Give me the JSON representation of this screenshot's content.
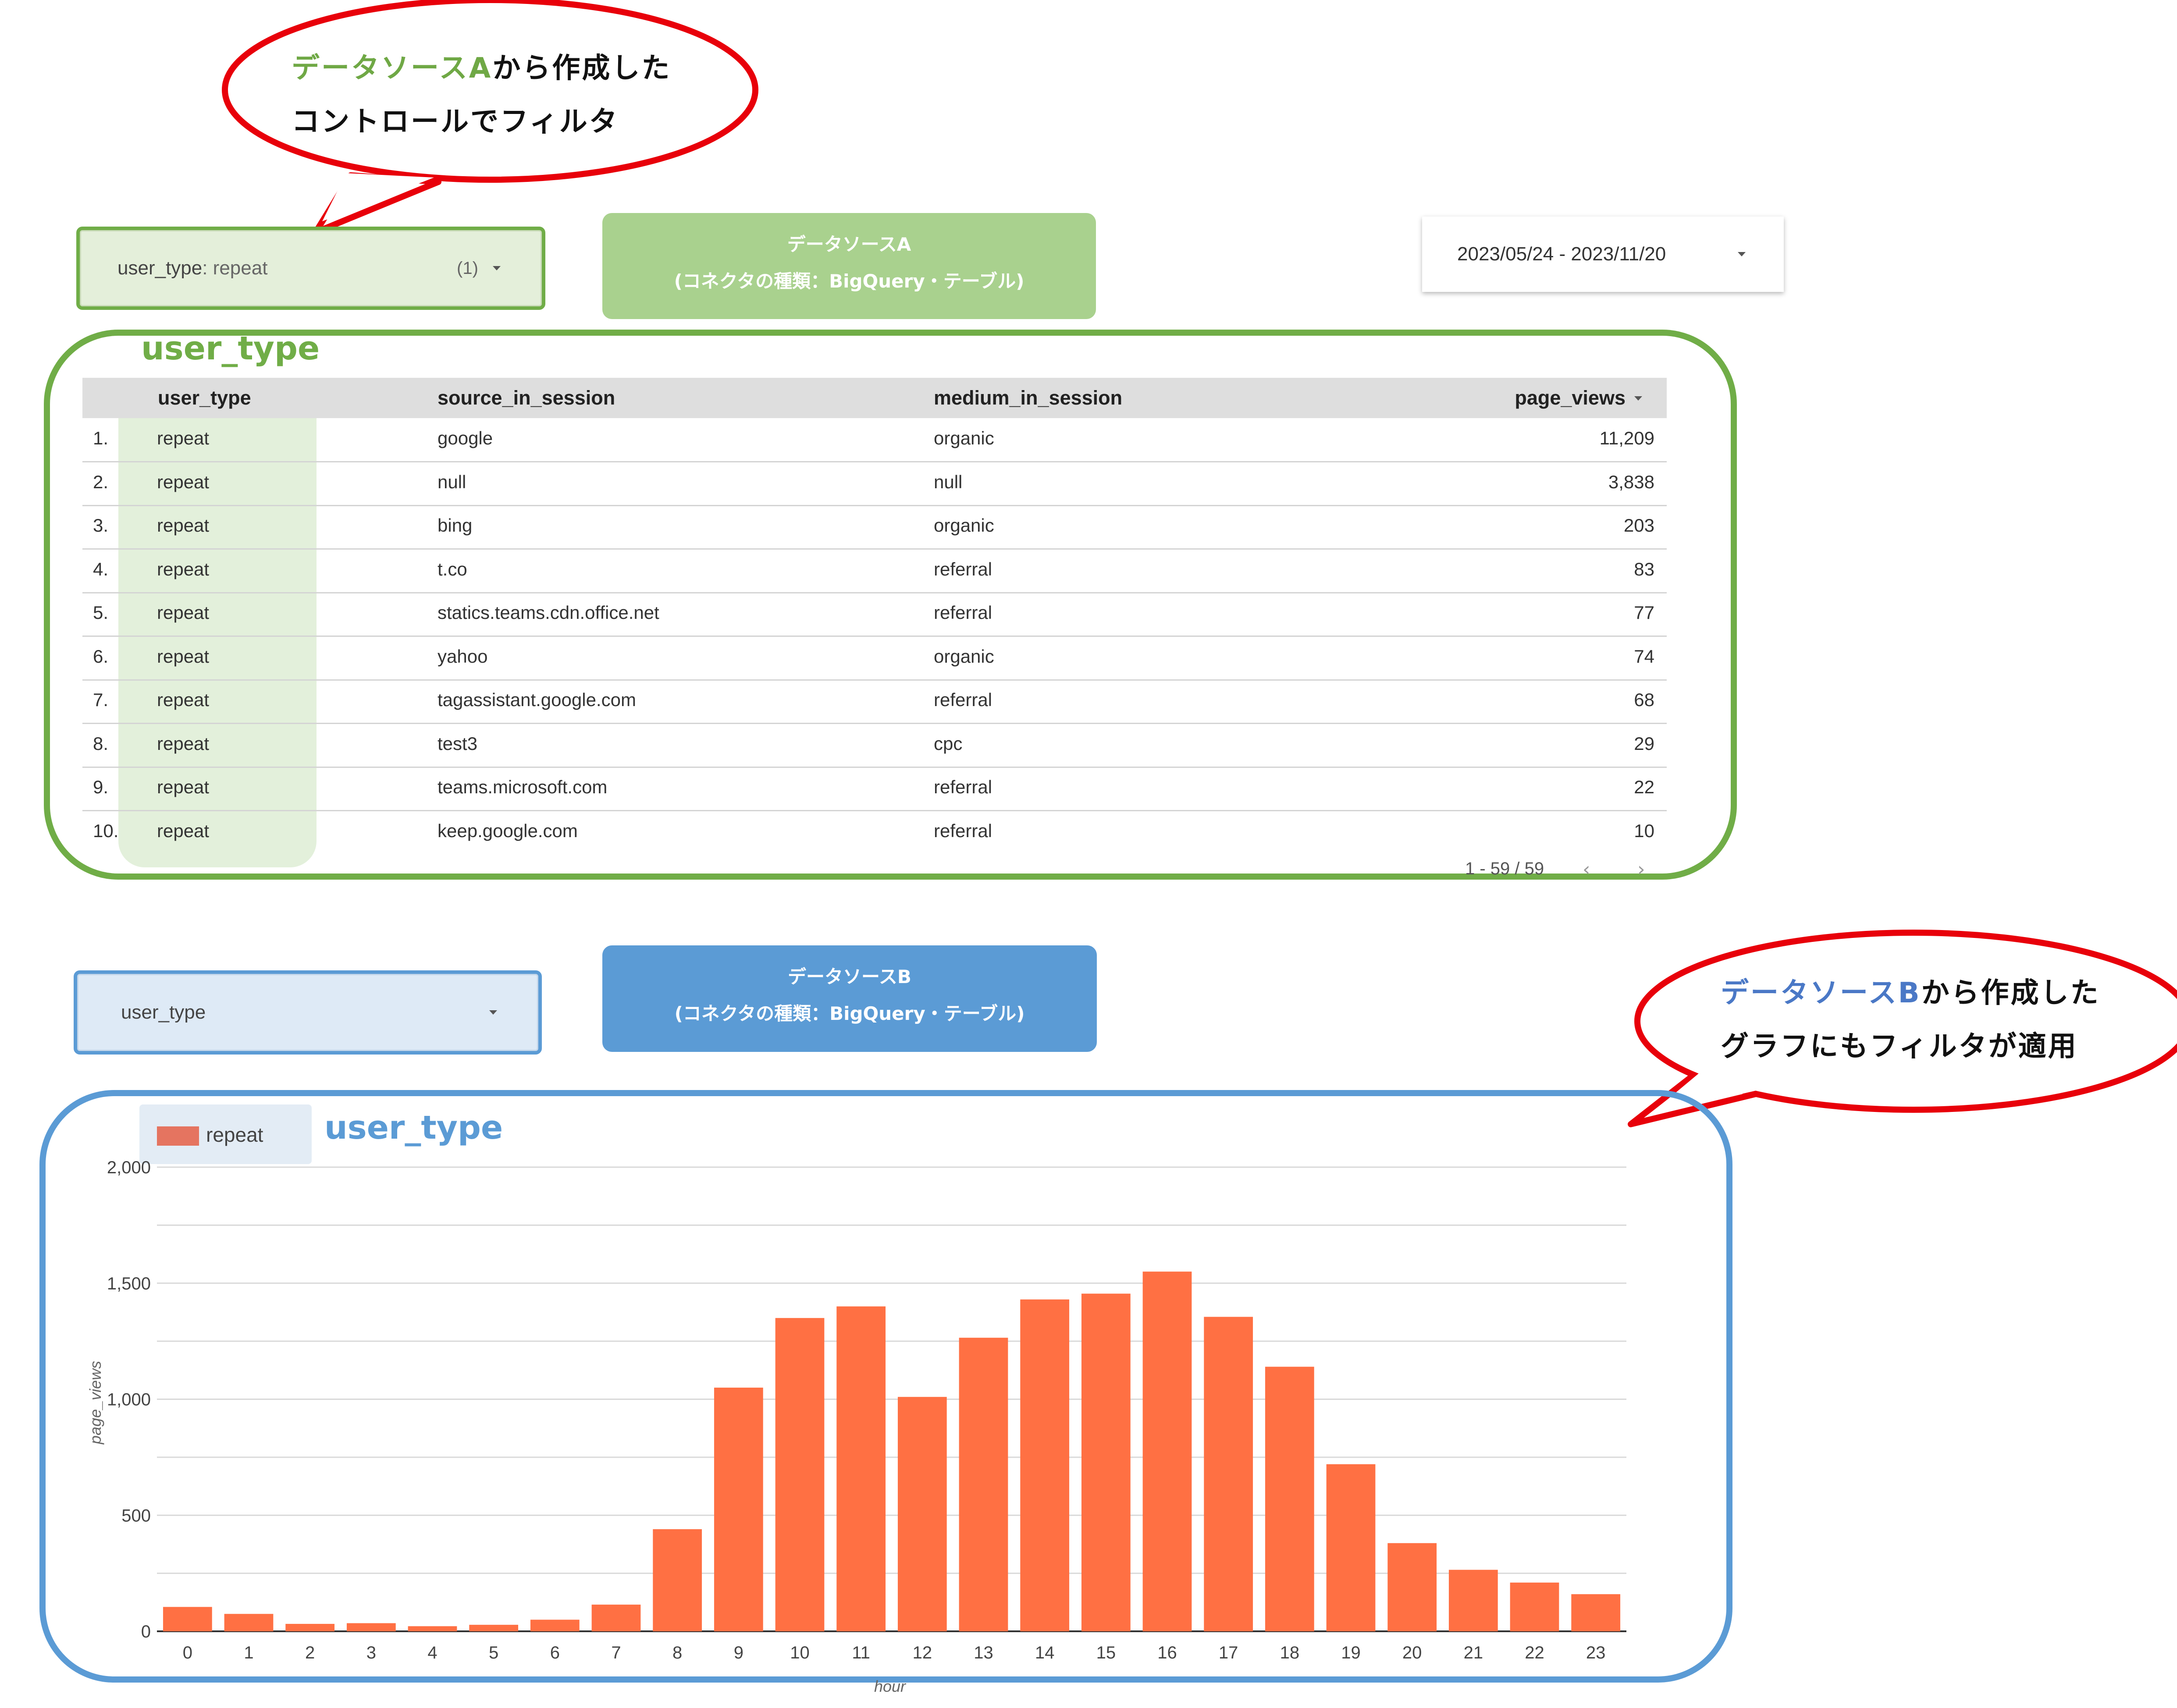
{
  "callout_a": {
    "line1_accent": "データソースA",
    "line1_rest": "から作成した",
    "line2": "コントロールでフィルタ"
  },
  "callout_b": {
    "line1_accent": "データソースB",
    "line1_rest": "から作成した",
    "line2": "グラフにもフィルタが適用"
  },
  "filter_a": {
    "label": "user_type",
    "value": ": repeat",
    "count": "(1)"
  },
  "filter_b": {
    "label": "user_type"
  },
  "datasource_a": {
    "title": "データソースA",
    "subtitle": "(コネクタの種類：BigQuery・テーブル)"
  },
  "datasource_b": {
    "title": "データソースB",
    "subtitle": "(コネクタの種類：BigQuery・テーブル)"
  },
  "date_range": {
    "value": "2023/05/24 - 2023/11/20"
  },
  "table_section": {
    "label": "user_type",
    "columns": [
      "user_type",
      "source_in_session",
      "medium_in_session",
      "page_views"
    ],
    "rows": [
      {
        "n": "1.",
        "user_type": "repeat",
        "source": "google",
        "medium": "organic",
        "views": "11,209"
      },
      {
        "n": "2.",
        "user_type": "repeat",
        "source": "null",
        "medium": "null",
        "views": "3,838"
      },
      {
        "n": "3.",
        "user_type": "repeat",
        "source": "bing",
        "medium": "organic",
        "views": "203"
      },
      {
        "n": "4.",
        "user_type": "repeat",
        "source": "t.co",
        "medium": "referral",
        "views": "83"
      },
      {
        "n": "5.",
        "user_type": "repeat",
        "source": "statics.teams.cdn.office.net",
        "medium": "referral",
        "views": "77"
      },
      {
        "n": "6.",
        "user_type": "repeat",
        "source": "yahoo",
        "medium": "organic",
        "views": "74"
      },
      {
        "n": "7.",
        "user_type": "repeat",
        "source": "tagassistant.google.com",
        "medium": "referral",
        "views": "68"
      },
      {
        "n": "8.",
        "user_type": "repeat",
        "source": "test3",
        "medium": "cpc",
        "views": "29"
      },
      {
        "n": "9.",
        "user_type": "repeat",
        "source": "teams.microsoft.com",
        "medium": "referral",
        "views": "22"
      },
      {
        "n": "10.",
        "user_type": "repeat",
        "source": "keep.google.com",
        "medium": "referral",
        "views": "10"
      }
    ],
    "pagination": "1 - 59 / 59"
  },
  "chart_section": {
    "label": "user_type",
    "legend": "repeat"
  },
  "colors": {
    "green": "#70ad47",
    "blue": "#5b9bd5",
    "bar": "#ff7043",
    "callout": "#e8000a"
  },
  "chart_data": {
    "type": "bar",
    "categories": [
      "0",
      "1",
      "2",
      "3",
      "4",
      "5",
      "6",
      "7",
      "8",
      "9",
      "10",
      "11",
      "12",
      "13",
      "14",
      "15",
      "16",
      "17",
      "18",
      "19",
      "20",
      "21",
      "22",
      "23"
    ],
    "series": [
      {
        "name": "repeat",
        "values": [
          105,
          75,
          32,
          35,
          22,
          28,
          50,
          115,
          440,
          1050,
          1350,
          1400,
          1010,
          1265,
          1430,
          1455,
          1550,
          1355,
          1140,
          720,
          380,
          265,
          210,
          160
        ]
      }
    ],
    "xlabel": "hour",
    "ylabel": "page_views",
    "ylim": [
      0,
      2000
    ],
    "yticks": [
      "0",
      "500",
      "1,000",
      "1,500",
      "2,000"
    ],
    "grid": true,
    "legend_position": "top-left"
  }
}
